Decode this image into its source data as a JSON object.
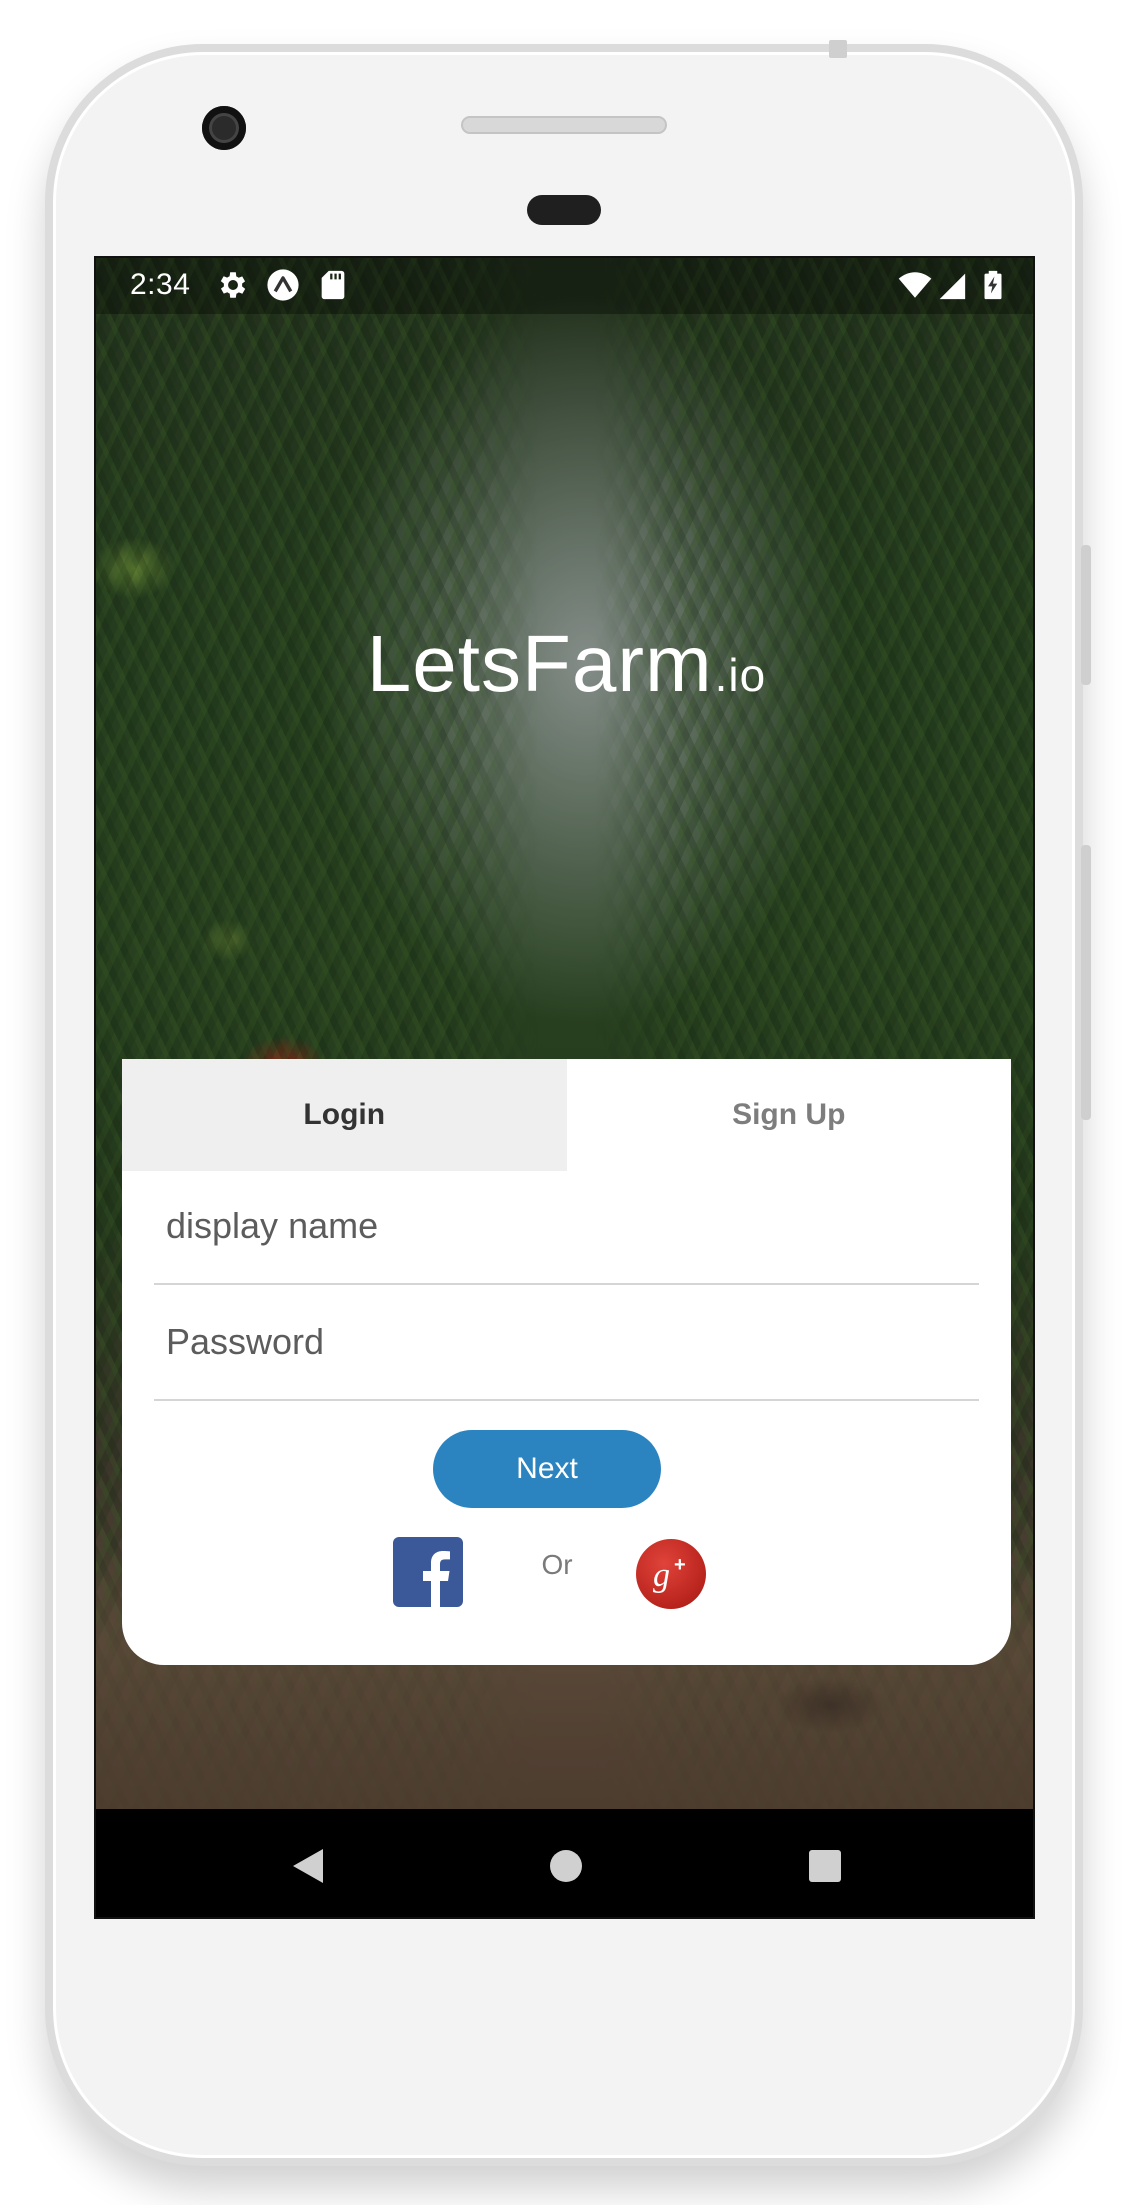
{
  "status_bar": {
    "time": "2:34",
    "left_icons": [
      "settings-icon",
      "expo-icon",
      "sd-card-icon"
    ],
    "right_icons": [
      "wifi-icon",
      "signal-icon",
      "battery-charging-icon"
    ]
  },
  "app": {
    "title": "LetsFarm",
    "title_suffix": ".io"
  },
  "auth_card": {
    "tabs": [
      {
        "label": "Login",
        "selected": true
      },
      {
        "label": "Sign Up",
        "selected": false
      }
    ],
    "display_name_field": {
      "placeholder": "display name",
      "value": ""
    },
    "password_field": {
      "placeholder": "Password",
      "value": ""
    },
    "next_button": "Next",
    "or_text": "Or",
    "social": [
      "facebook-icon",
      "google-plus-icon"
    ]
  },
  "nav_bar": {
    "buttons": [
      "back-icon",
      "home-icon",
      "recents-icon"
    ]
  },
  "colors": {
    "primary_button": "#2b84bf",
    "facebook": "#3b5998",
    "google_plus": "#c5312a",
    "active_tab_bg": "#efefef"
  }
}
